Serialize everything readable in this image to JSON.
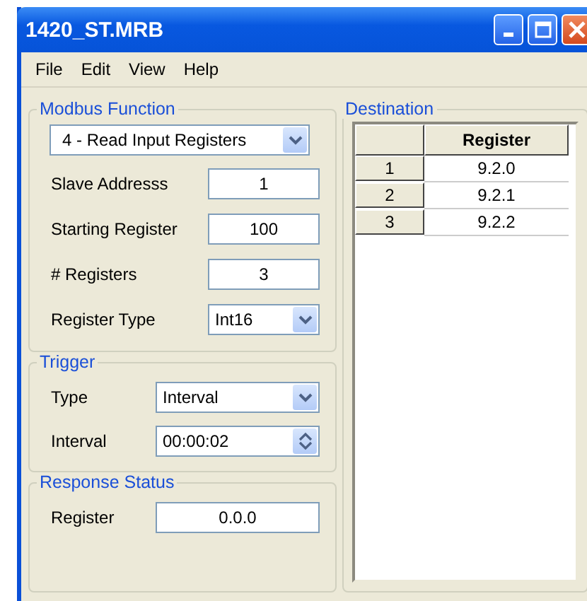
{
  "window": {
    "title": "1420_ST.MRB"
  },
  "menu": [
    "File",
    "Edit",
    "View",
    "Help"
  ],
  "modbus_function": {
    "title": "Modbus Function",
    "function": "4 - Read Input Registers",
    "fields": [
      {
        "kind": "text",
        "label": "Slave Addresss",
        "value": "1"
      },
      {
        "kind": "text",
        "label": "Starting Register",
        "value": "100"
      },
      {
        "kind": "text",
        "label": "# Registers",
        "value": "3"
      },
      {
        "kind": "combo",
        "label": "Register Type",
        "value": "Int16"
      }
    ]
  },
  "trigger": {
    "title": "Trigger",
    "fields": [
      {
        "kind": "combo",
        "label": "Type",
        "value": "Interval"
      },
      {
        "kind": "spin",
        "label": "Interval",
        "value": "00:00:02"
      }
    ]
  },
  "response_status": {
    "title": "Response Status",
    "fields": [
      {
        "kind": "text",
        "label": "Register",
        "value": "0.0.0"
      }
    ]
  },
  "destination": {
    "title": "Destination",
    "columns": [
      "Register"
    ],
    "rows": [
      {
        "index": "1",
        "register": "9.2.0"
      },
      {
        "index": "2",
        "register": "9.2.1"
      },
      {
        "index": "3",
        "register": "9.2.2"
      }
    ]
  }
}
